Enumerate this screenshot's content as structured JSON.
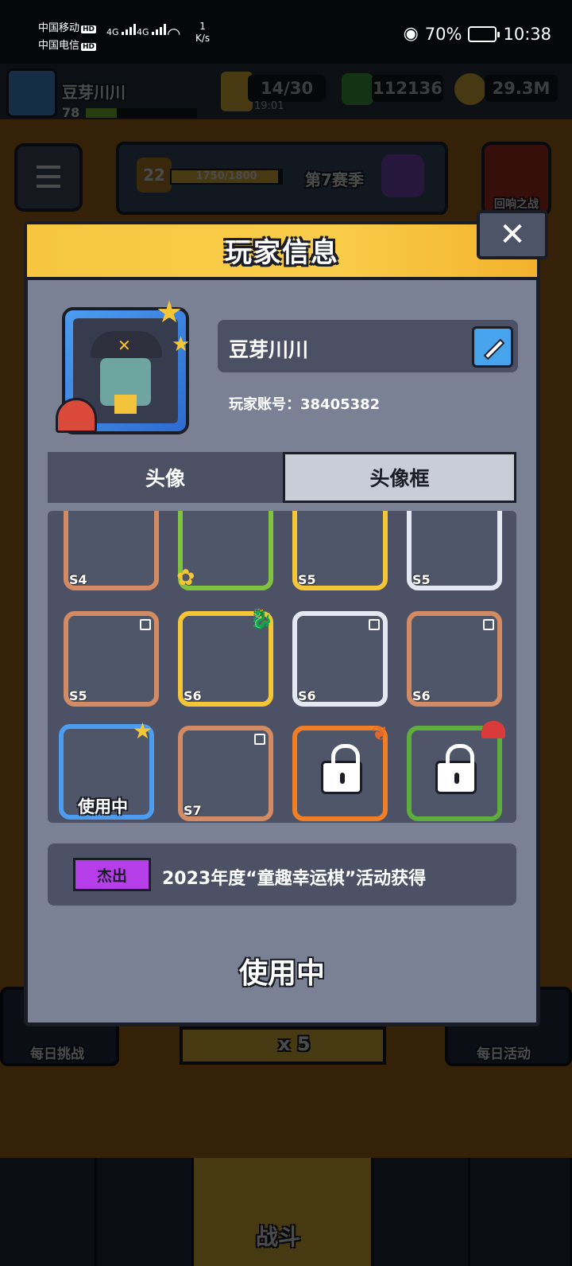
{
  "status_bar": {
    "carrier1": "中国移动",
    "carrier2": "中国电信",
    "hd": "HD",
    "net1": "4G",
    "net2": "4G",
    "speed_value": "1",
    "speed_unit": "K/s",
    "battery": "70%",
    "time": "10:38"
  },
  "game": {
    "player_name": "豆芽川川",
    "player_level": "78",
    "energy": "14/30",
    "energy_timer": "19:01",
    "gems": "112136",
    "coins": "29.3M",
    "season_level": "22",
    "season_progress": "1750/1800",
    "season_progress_fraction": 0.972,
    "season_name": "第7赛季",
    "battle_button_label": "回响之战",
    "daily_challenge": "每日挑战",
    "daily_activity": "每日活动",
    "energy_multiplier": "x 5",
    "nav_battle": "战斗"
  },
  "modal": {
    "title": "玩家信息",
    "close_label": "✕",
    "name": "豆芽川川",
    "account_label": "玩家账号：38405382",
    "tabs": [
      {
        "label": "头像",
        "active": false
      },
      {
        "label": "头像框",
        "active": true
      }
    ],
    "frames": [
      {
        "tag": "S4",
        "color": "#d48a63"
      },
      {
        "tag": "",
        "color": "#7ec23e"
      },
      {
        "tag": "S5",
        "color": "#f5c636"
      },
      {
        "tag": "S5",
        "color": "#e4e8f0"
      },
      {
        "tag": "S5",
        "color": "#d48a63"
      },
      {
        "tag": "S6",
        "color": "#f5c636"
      },
      {
        "tag": "S6",
        "color": "#e4e8f0"
      },
      {
        "tag": "S6",
        "color": "#d48a63"
      },
      {
        "tag": "",
        "color": "#4c9cf0",
        "in_use_label": "使用中"
      },
      {
        "tag": "S7",
        "color": "#d48a63"
      },
      {
        "tag": "",
        "color": "#f07e23",
        "locked": true
      },
      {
        "tag": "",
        "color": "#5dae3d",
        "locked": true
      }
    ],
    "rarity_badge": "杰出",
    "description": "2023年度“童趣幸运棋”活动获得",
    "status_label": "使用中"
  },
  "colors": {
    "header_yellow": "#f6c640",
    "modal_bg": "#7a8194",
    "rarity_purple": "#b53ee8",
    "edit_blue": "#47a3ec"
  }
}
